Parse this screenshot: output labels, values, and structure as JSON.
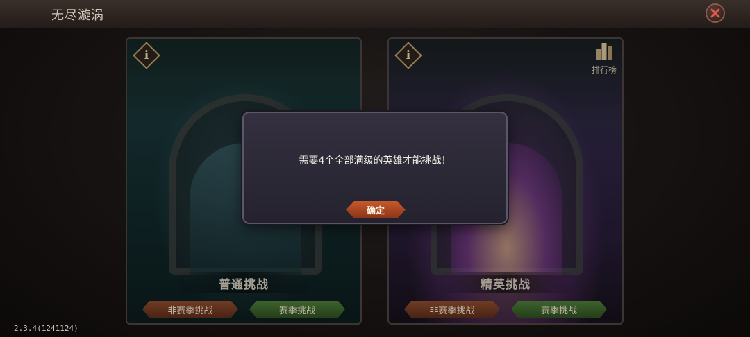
{
  "header": {
    "title": "无尽漩涡",
    "close_icon": "close-icon"
  },
  "cards": [
    {
      "id": "normal",
      "title": "普通挑战",
      "info_icon_label": "i",
      "buttons": {
        "off_season": "非赛季挑战",
        "season": "赛季挑战"
      }
    },
    {
      "id": "elite",
      "title": "精英挑战",
      "info_icon_label": "i",
      "buttons": {
        "off_season": "非赛季挑战",
        "season": "赛季挑战"
      }
    }
  ],
  "leaderboard": {
    "label": "排行榜",
    "icon": "leaderboard-icon"
  },
  "modal": {
    "message": "需要4个全部满级的英雄才能挑战！",
    "confirm_label": "确定"
  },
  "version": "2.3.4(1241124)",
  "colors": {
    "accent_orange": "#c65a2c",
    "accent_green": "#4c7a36"
  }
}
